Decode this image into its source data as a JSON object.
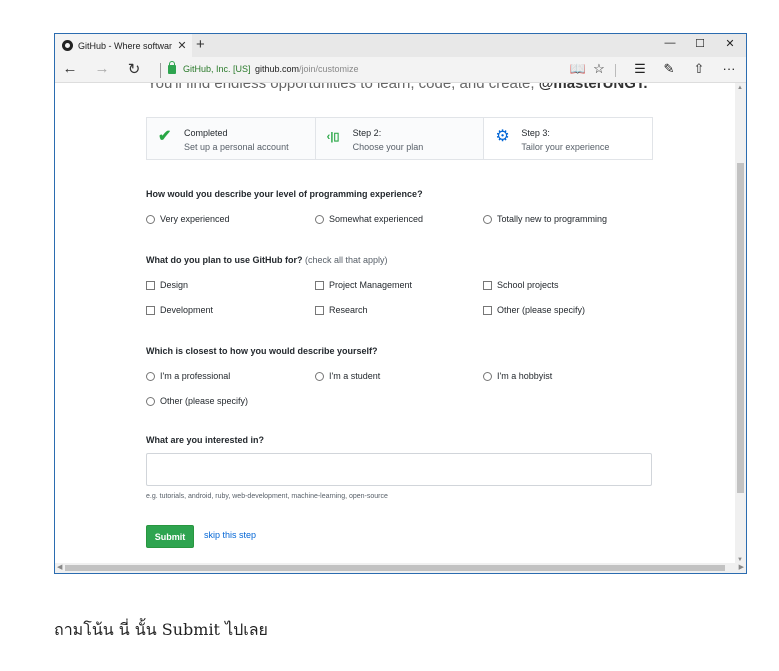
{
  "browser": {
    "tab_title": "GitHub - Where softwar",
    "tab_close": "✕",
    "new_tab": "+",
    "minimize": "—",
    "maximize": "☐",
    "close": "✕",
    "back": "←",
    "forward": "→",
    "refresh": "↻",
    "cert_name": "GitHub, Inc. [US]",
    "url_host": "github.com",
    "url_path": "/join/customize",
    "reading_view": "📖",
    "favorite": "☆",
    "hub": "☰",
    "notes": "✎",
    "share": "⇧",
    "more": "···"
  },
  "intro": {
    "text": "You'll find endless opportunities to learn, code, and create, ",
    "username": "@masterUNGT."
  },
  "steps": [
    {
      "title": "Completed",
      "subtitle": "Set up a personal account",
      "icon": "check-icon"
    },
    {
      "title": "Step 2:",
      "subtitle": "Choose your plan",
      "icon": "plan-icon"
    },
    {
      "title": "Step 3:",
      "subtitle": "Tailor your experience",
      "icon": "gear-icon"
    }
  ],
  "q1": {
    "label": "How would you describe your level of programming experience?",
    "options": [
      "Very experienced",
      "Somewhat experienced",
      "Totally new to programming"
    ]
  },
  "q2": {
    "label": "What do you plan to use GitHub for?",
    "hint": "(check all that apply)",
    "options": [
      "Design",
      "Project Management",
      "School projects",
      "Development",
      "Research",
      "Other (please specify)"
    ]
  },
  "q3": {
    "label": "Which is closest to how you would describe yourself?",
    "options": [
      "I'm a professional",
      "I'm a student",
      "I'm a hobbyist",
      "Other (please specify)"
    ]
  },
  "q4": {
    "label": "What are you interested in?",
    "value": "",
    "help": "e.g. tutorials, android, ruby, web-development, machine-learning, open-source"
  },
  "actions": {
    "submit": "Submit",
    "skip": "skip this step"
  },
  "caption": "ถามโน้น นี่ นั้น Submit ไปเลย",
  "colors": {
    "accent_green": "#2ea44f",
    "link_blue": "#0366d6"
  }
}
